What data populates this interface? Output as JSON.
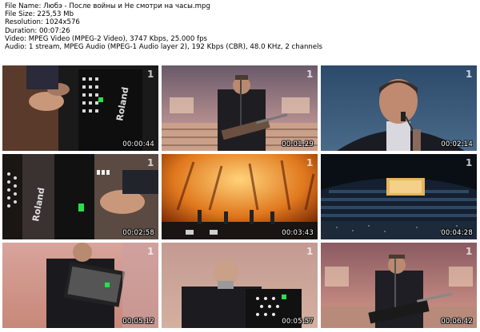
{
  "file_info": {
    "name": "File Name: Любэ - После войны и Не смотри на часы.mpg",
    "size": "File Size: 225,53 Mb",
    "resolution": "Resolution: 1024x576",
    "duration": "Duration: 00:07:26",
    "video": "Video: MPEG Video (MPEG-2 Video), 3747 Kbps, 25.000 fps",
    "audio": "Audio: 1 stream, MPEG Audio (MPEG-1 Audio layer 2), 192 Kbps (CBR), 48.0 KHz, 2 channels"
  },
  "thumbnails": [
    {
      "timestamp": "00:00:44",
      "scene": "accordion-closeup",
      "logo": "1"
    },
    {
      "timestamp": "00:01:29",
      "scene": "singer-guitar-stage",
      "logo": "1"
    },
    {
      "timestamp": "00:02:14",
      "scene": "singer-closeup",
      "logo": "1"
    },
    {
      "timestamp": "00:02:58",
      "scene": "roland-accordion",
      "logo": "1"
    },
    {
      "timestamp": "00:03:43",
      "scene": "stage-wide-orange",
      "logo": "1"
    },
    {
      "timestamp": "00:04:28",
      "scene": "arena-wide",
      "logo": "1"
    },
    {
      "timestamp": "00:05:12",
      "scene": "accordion-player",
      "logo": "1"
    },
    {
      "timestamp": "00:05:57",
      "scene": "accordion-player-bald",
      "logo": "1"
    },
    {
      "timestamp": "00:06:42",
      "scene": "singer-guitar-stage",
      "logo": "1"
    }
  ],
  "colors": {
    "background": "#ffffff",
    "timestamp_text": "#ffffff"
  }
}
